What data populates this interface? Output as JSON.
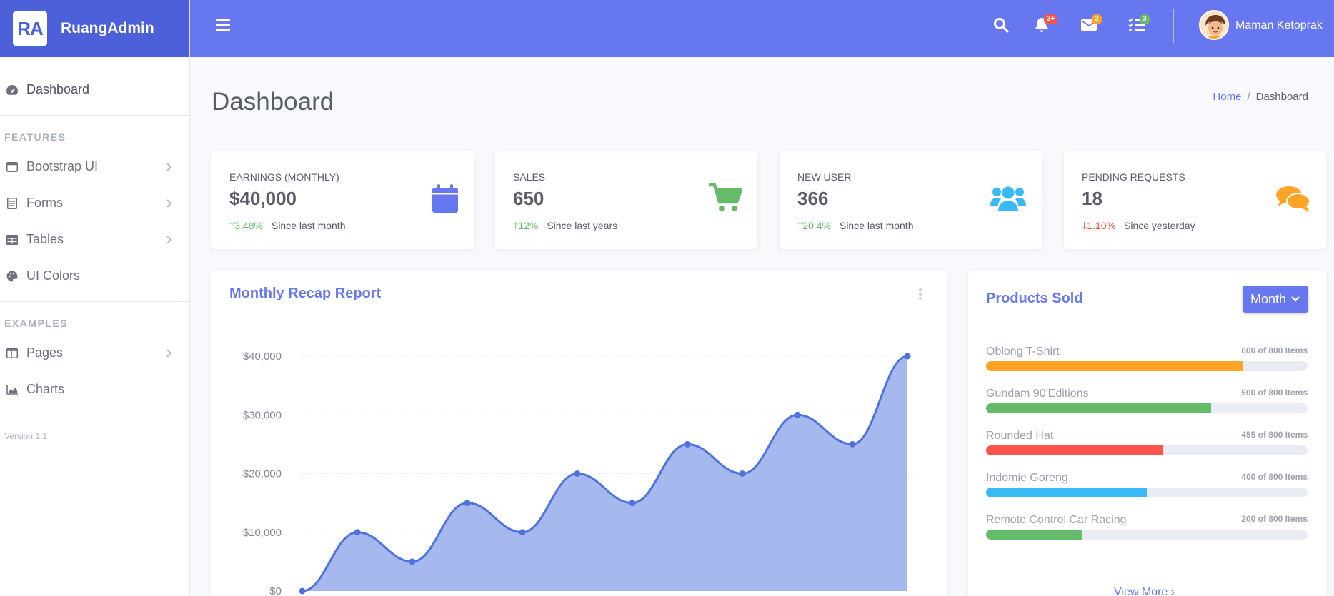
{
  "brand": {
    "logo": "RA",
    "name": "RuangAdmin"
  },
  "sidebar": {
    "dashboard": "Dashboard",
    "features_heading": "FEATURES",
    "features": [
      {
        "label": "Bootstrap UI",
        "icon": "window-icon"
      },
      {
        "label": "Forms",
        "icon": "form-icon"
      },
      {
        "label": "Tables",
        "icon": "table-icon"
      },
      {
        "label": "UI Colors",
        "icon": "palette-icon"
      }
    ],
    "examples_heading": "EXAMPLES",
    "examples": [
      {
        "label": "Pages",
        "icon": "columns-icon"
      },
      {
        "label": "Charts",
        "icon": "area-chart-icon"
      }
    ],
    "version": "Version 1.1"
  },
  "topbar": {
    "alerts_badge": "3+",
    "messages_badge": "2",
    "tasks_badge": "3",
    "username": "Maman Ketoprak"
  },
  "page": {
    "title": "Dashboard",
    "breadcrumb_home": "Home",
    "breadcrumb_sep": "/",
    "breadcrumb_current": "Dashboard"
  },
  "stats": [
    {
      "label": "Earnings (Monthly)",
      "value": "$40,000",
      "delta": "3.48%",
      "since": "Since last month",
      "trend": "up",
      "icon": "calendar-icon",
      "color": "#6777ef"
    },
    {
      "label": "Sales",
      "value": "650",
      "delta": "12%",
      "since": "Since last years",
      "trend": "up",
      "icon": "cart-icon",
      "color": "#66bb6a"
    },
    {
      "label": "New User",
      "value": "366",
      "delta": "20.4%",
      "since": "Since last month",
      "trend": "up",
      "icon": "users-icon",
      "color": "#3abaf4"
    },
    {
      "label": "Pending Requests",
      "value": "18",
      "delta": "1.10%",
      "since": "Since yesterday",
      "trend": "down",
      "icon": "comments-icon",
      "color": "#ffa426"
    }
  ],
  "recap": {
    "title": "Monthly Recap Report"
  },
  "chart_data": {
    "type": "area",
    "title": "Monthly Recap Report",
    "ylabel_ticks": [
      "$0",
      "$10,000",
      "$20,000",
      "$30,000",
      "$40,000"
    ],
    "ylim": [
      0,
      40000
    ],
    "values": [
      0,
      10000,
      5000,
      15000,
      10000,
      20000,
      15000,
      25000,
      20000,
      30000,
      25000,
      40000
    ],
    "grid": true,
    "color": "#4e73df"
  },
  "products": {
    "title": "Products Sold",
    "filter": "Month",
    "items": [
      {
        "name": "Oblong T-Shirt",
        "count": "600 of 800 Items",
        "fraction": 0.8,
        "color": "#ffa426"
      },
      {
        "name": "Gundam 90'Editions",
        "count": "500 of 800 Items",
        "fraction": 0.7,
        "color": "#66bb6a"
      },
      {
        "name": "Rounded Hat",
        "count": "455 of 800 Items",
        "fraction": 0.55,
        "color": "#fc544b"
      },
      {
        "name": "Indomie Goreng",
        "count": "400 of 800 Items",
        "fraction": 0.5,
        "color": "#3abaf4"
      },
      {
        "name": "Remote Control Car Racing",
        "count": "200 of 800 Items",
        "fraction": 0.3,
        "color": "#66bb6a"
      }
    ],
    "view_more": "View More"
  }
}
